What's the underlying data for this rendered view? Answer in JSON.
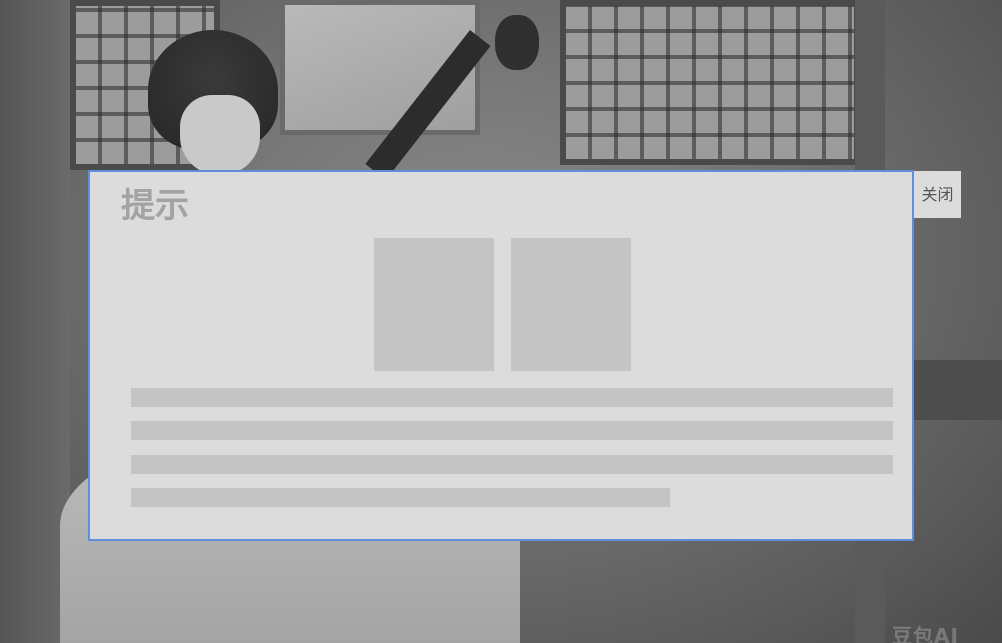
{
  "modal": {
    "title": "提示",
    "image_placeholders": 2,
    "text_line_placeholders": 4
  },
  "close_button": {
    "label": "关闭"
  },
  "background": {
    "description_watermark": "豆包AI"
  },
  "colors": {
    "modal_background": "#dcdcdc",
    "modal_border": "#5f8fd8",
    "placeholder": "#c4c4c4",
    "title_text": "#a3a3a3"
  }
}
